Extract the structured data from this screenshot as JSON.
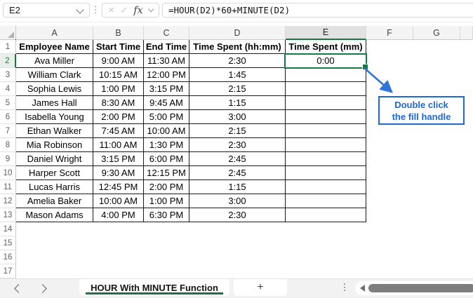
{
  "formula_bar": {
    "name_box_value": "E2",
    "formula": "=HOUR(D2)*60+MINUTE(D2)",
    "fx_label": "fx"
  },
  "icons": {
    "cancel": "×",
    "enter": "✓",
    "vertical_dots": "⋮"
  },
  "sheet": {
    "column_headers": [
      "A",
      "B",
      "C",
      "D",
      "E",
      "F",
      "G"
    ],
    "selected_column": "E",
    "row_numbers": [
      1,
      2,
      3,
      4,
      5,
      6,
      7,
      8,
      9,
      10,
      11,
      12,
      13,
      14,
      15,
      16,
      17
    ],
    "selected_row": 2,
    "active_cell": {
      "ref": "E2",
      "value": "0:00"
    },
    "table": {
      "headers": [
        "Employee Name",
        "Start Time",
        "End Time",
        "Time Spent (hh:mm)",
        "Time Spent (mm)"
      ],
      "rows": [
        [
          "Ava Miller",
          "9:00 AM",
          "11:30 AM",
          "2:30",
          "0:00"
        ],
        [
          "William Clark",
          "10:15 AM",
          "12:00 PM",
          "1:45",
          ""
        ],
        [
          "Sophia Lewis",
          "1:00 PM",
          "3:15 PM",
          "2:15",
          ""
        ],
        [
          "James Hall",
          "8:30 AM",
          "9:45 AM",
          "1:15",
          ""
        ],
        [
          "Isabella Young",
          "2:00 PM",
          "5:00 PM",
          "3:00",
          ""
        ],
        [
          "Ethan Walker",
          "7:45 AM",
          "10:00 AM",
          "2:15",
          ""
        ],
        [
          "Mia Robinson",
          "11:00 AM",
          "1:30 PM",
          "2:30",
          ""
        ],
        [
          "Daniel Wright",
          "3:15 PM",
          "6:00 PM",
          "2:45",
          ""
        ],
        [
          "Harper Scott",
          "9:30 AM",
          "12:15 PM",
          "2:45",
          ""
        ],
        [
          "Lucas Harris",
          "12:45 PM",
          "2:00 PM",
          "1:15",
          ""
        ],
        [
          "Amelia Baker",
          "10:00 AM",
          "1:00 PM",
          "3:00",
          ""
        ],
        [
          "Mason Adams",
          "4:00 PM",
          "6:30 PM",
          "2:30",
          ""
        ]
      ]
    }
  },
  "callout": {
    "line1": "Double click",
    "line2": "the fill handle"
  },
  "sheet_tabs": {
    "active_tab": "HOUR With MINUTE Function",
    "add_tab_label": "+"
  },
  "colors": {
    "excel_green": "#107C41",
    "callout_blue": "#1e68d2",
    "arrow_blue": "#2e74d9"
  }
}
